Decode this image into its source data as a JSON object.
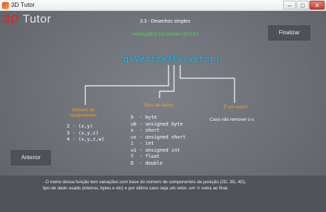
{
  "window": {
    "title": "3D Tutor",
    "buttons": {
      "minimize": "–",
      "maximize": "□",
      "close": "✕"
    }
  },
  "logo": {
    "part1": "3D",
    "part2": "Tutor"
  },
  "header": {
    "section": "3.3 - Desenhos simples",
    "subtitle": "VARIAÇÕES DO DRAW VERTEX"
  },
  "buttons": {
    "finalizar": "Finalizar",
    "anterior": "Anterior"
  },
  "function_signature": "glVertex2fv(vetor)",
  "annotations": {
    "componentes": {
      "label_line1": "Número de",
      "label_line2": "componentes",
      "items": [
        "2 - (x,y)",
        "3 - (x,y,z)",
        "4 - (x,y,z,w)"
      ]
    },
    "tipos": {
      "label": "Tipos de dados",
      "items": [
        "b  - byte",
        "ub - unsigned byte",
        "s  - short",
        "us - unsigned short",
        "i  - int",
        "ui - unsigned int",
        "f  - float",
        "D  - double"
      ]
    },
    "vetor": {
      "label": "É um vetor?",
      "note": "Caso não remover o v."
    }
  },
  "footer": {
    "line1": "- O nome dessa função tem variações com base do número de componentes da posição (2D, 3D, 4D),",
    "line2": "tipo de dado usado (inteiros, bytes e etc) e por último caso seja um vetor, um 'v' extra ao final."
  },
  "colors": {
    "accent_cyan": "#18c2ec",
    "label_orange": "#f2a11e",
    "subtitle_green": "#46e046",
    "logo_red": "#d62a2a"
  }
}
